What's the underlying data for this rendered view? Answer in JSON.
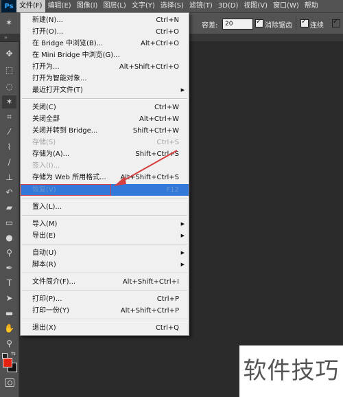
{
  "app": {
    "logo": "Ps"
  },
  "menubar": {
    "items": [
      "文件(F)",
      "编辑(E)",
      "图像(I)",
      "图层(L)",
      "文字(Y)",
      "选择(S)",
      "滤镜(T)",
      "3D(D)",
      "视图(V)",
      "窗口(W)",
      "帮助"
    ]
  },
  "options": {
    "tolerance_label": "容差:",
    "tolerance_value": "20",
    "antialias_label": "消除锯齿",
    "contiguous_label": "连续"
  },
  "file_menu": {
    "items": [
      {
        "label": "新建(N)...",
        "shortcut": "Ctrl+N"
      },
      {
        "label": "打开(O)...",
        "shortcut": "Ctrl+O"
      },
      {
        "label": "在 Bridge 中浏览(B)...",
        "shortcut": "Alt+Ctrl+O"
      },
      {
        "label": "在 Mini Bridge 中浏览(G)...",
        "shortcut": ""
      },
      {
        "label": "打开为...",
        "shortcut": "Alt+Shift+Ctrl+O"
      },
      {
        "label": "打开为智能对象...",
        "shortcut": ""
      },
      {
        "label": "最近打开文件(T)",
        "shortcut": ""
      },
      {
        "label": "关闭(C)",
        "shortcut": "Ctrl+W"
      },
      {
        "label": "关闭全部",
        "shortcut": "Alt+Ctrl+W"
      },
      {
        "label": "关闭并转到 Bridge...",
        "shortcut": "Shift+Ctrl+W"
      },
      {
        "label": "存储(S)",
        "shortcut": "Ctrl+S"
      },
      {
        "label": "存储为(A)...",
        "shortcut": "Shift+Ctrl+S"
      },
      {
        "label": "签入(I)...",
        "shortcut": ""
      },
      {
        "label": "存储为 Web 所用格式...",
        "shortcut": "Alt+Shift+Ctrl+S"
      },
      {
        "label": "恢复(V)",
        "shortcut": "F12"
      },
      {
        "label": "置入(L)...",
        "shortcut": ""
      },
      {
        "label": "导入(M)",
        "shortcut": ""
      },
      {
        "label": "导出(E)",
        "shortcut": ""
      },
      {
        "label": "自动(U)",
        "shortcut": ""
      },
      {
        "label": "脚本(R)",
        "shortcut": ""
      },
      {
        "label": "文件简介(F)...",
        "shortcut": "Alt+Shift+Ctrl+I"
      },
      {
        "label": "打印(P)...",
        "shortcut": "Ctrl+P"
      },
      {
        "label": "打印一份(Y)",
        "shortcut": "Alt+Shift+Ctrl+P"
      },
      {
        "label": "退出(X)",
        "shortcut": "Ctrl+Q"
      }
    ]
  },
  "watermark": {
    "text": "软件技巧"
  },
  "colors": {
    "foreground": "#e3210f",
    "background": "#111111",
    "highlight": "#3379d9",
    "annotation": "#d64040"
  }
}
